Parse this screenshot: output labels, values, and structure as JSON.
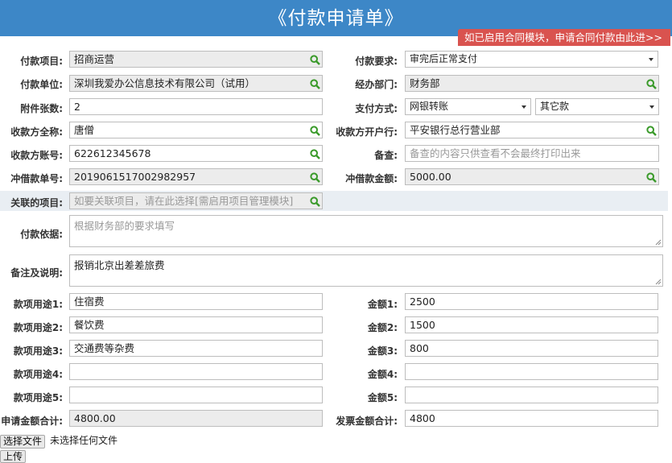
{
  "top_button": "上传",
  "title": "《付款申请单》",
  "contract_link": "如已启用合同模块，申请合同付款由此进>>",
  "fields": {
    "project": {
      "label": "付款项目:",
      "value": "招商运营"
    },
    "requirement": {
      "label": "付款要求:",
      "value": "审完后正常支付"
    },
    "unit": {
      "label": "付款单位:",
      "value": "深圳我爱办公信息技术有限公司（试用）"
    },
    "dept": {
      "label": "经办部门:",
      "value": "财务部"
    },
    "attachments": {
      "label": "附件张数:",
      "value": "2"
    },
    "pay_method": {
      "label": "支付方式:",
      "value": "网银转账",
      "value2": "其它款"
    },
    "payee_name": {
      "label": "收款方全称:",
      "value": "唐僧"
    },
    "payee_bank": {
      "label": "收款方开户行:",
      "value": "平安银行总行营业部"
    },
    "payee_account": {
      "label": "收款方账号:",
      "value": "622612345678"
    },
    "remark_check": {
      "label": "备查:",
      "placeholder": "备查的内容只供查看不会最终打印出来"
    },
    "loan_no": {
      "label": "冲借款单号:",
      "value": "2019061517002982957"
    },
    "loan_amount": {
      "label": "冲借款金额:",
      "value": "5000.00"
    },
    "related_project": {
      "label": "关联的项目:",
      "placeholder": "如要关联项目，请在此选择[需启用项目管理模块]"
    },
    "basis": {
      "label": "付款依据:",
      "placeholder": "根据财务部的要求填写"
    },
    "notes": {
      "label": "备注及说明:",
      "value": "报销北京出差差旅费"
    }
  },
  "items": [
    {
      "use_label": "款项用途1:",
      "use": "住宿费",
      "amt_label": "金额1:",
      "amt": "2500"
    },
    {
      "use_label": "款项用途2:",
      "use": "餐饮费",
      "amt_label": "金额2:",
      "amt": "1500"
    },
    {
      "use_label": "款项用途3:",
      "use": "交通费等杂费",
      "amt_label": "金额3:",
      "amt": "800"
    },
    {
      "use_label": "款项用途4:",
      "use": "",
      "amt_label": "金额4:",
      "amt": ""
    },
    {
      "use_label": "款项用途5:",
      "use": "",
      "amt_label": "金额5:",
      "amt": ""
    }
  ],
  "totals": {
    "apply_label": "申请金额合计:",
    "apply_value": "4800.00",
    "invoice_label": "发票金额合计:",
    "invoice_value": "4800"
  },
  "file": {
    "button": "选择文件",
    "status": "未选择任何文件"
  },
  "bottom_button": "上传",
  "colors": {
    "header": "#3d87c7",
    "contract_bg": "#d9534f",
    "search_icon": "#3a9a2a"
  },
  "icons": {
    "lookup": "search-icon",
    "dropdown": "chevron-down-icon",
    "resize": "resize-grip-icon"
  }
}
